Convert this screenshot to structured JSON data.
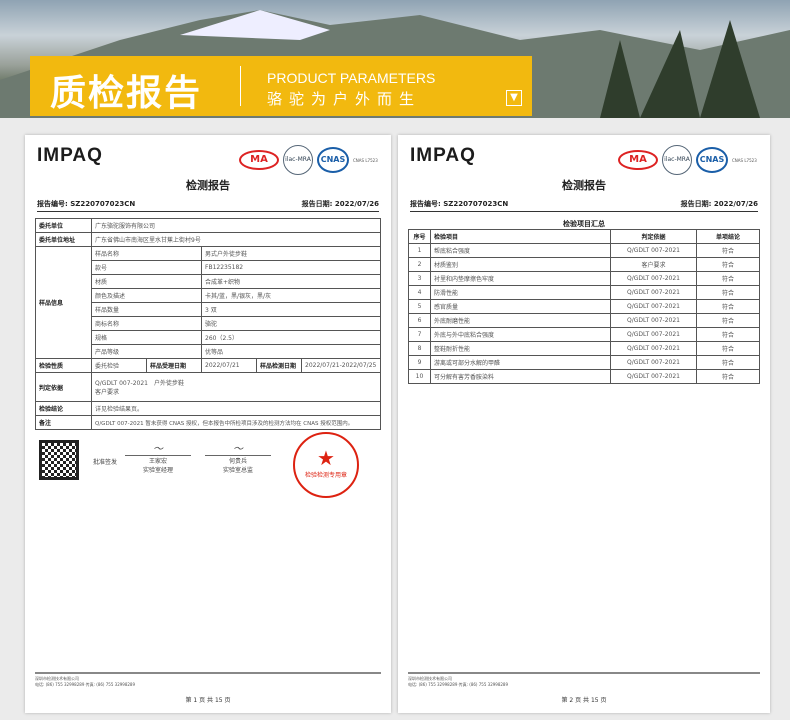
{
  "banner": {
    "title": "质检报告",
    "en": "PRODUCT PARAMETERS",
    "sub": "骆驼为户外而生",
    "download_icon": "chevron-down-icon"
  },
  "logo": "IMPAQ",
  "certs": {
    "ma": "MA",
    "ilac": "ilac-MRA",
    "cnas": "CNAS",
    "cnas_text": "CNAS L7523"
  },
  "page1": {
    "title": "检测报告",
    "report_no": "报告编号: SZ220707023CN",
    "report_date": "报告日期: 2022/07/26",
    "client_label": "委托单位",
    "client": "广东骆驼服饰有限公司",
    "address_label": "委托单位地址",
    "address": "广东省佛山市南海区里水甘蕉上街村9号",
    "sample_label": "样品信息",
    "sample": [
      [
        "样品名称",
        "男式户外徒步鞋"
      ],
      [
        "款号",
        "FB12235182"
      ],
      [
        "材质",
        "合成革+织物"
      ],
      [
        "颜色及描述",
        "卡其/蓝，黑/银灰，黑/灰"
      ],
      [
        "样品数量",
        "3 双"
      ],
      [
        "商标名称",
        "骆驼"
      ],
      [
        "规格",
        "260（2.5）"
      ],
      [
        "产品等级",
        "优等品"
      ]
    ],
    "nature_label": "检验性质",
    "nature": "委托检验",
    "recv_label": "样品受理日期",
    "recv": "2022/07/21",
    "test_label": "样品检测日期",
    "test": "2022/07/21-2022/07/25",
    "basis_label": "判定依据",
    "basis1": "Q/GDLT 007-2021　户外徒步鞋",
    "basis2": "客户要求",
    "conclusion_label": "检验结论",
    "conclusion": "详见检验结果页。",
    "remark_label": "备注",
    "remark": "Q/GDLT 007-2021 暂未获得 CNAS 授权，但本报告中所检项目涉及的检测方法均在 CNAS 授权范围内。",
    "sign_label": "批准签发",
    "signer1": "王家宏",
    "role1": "实验室经理",
    "signer2": "何贵兵",
    "role2": "实验室总监",
    "stamp": "检验检测专用章",
    "footer1": "深圳市检测技术有限公司",
    "footer2": "电话: (86) 755 32998289 传真: (86) 755 32998289",
    "page": "第 1 页 共 15 页"
  },
  "page2": {
    "title": "检测报告",
    "report_no": "报告编号: SZ220707023CN",
    "report_date": "报告日期: 2022/07/26",
    "summary_title": "检验项目汇总",
    "headers": [
      "序号",
      "检验项目",
      "判定依据",
      "单项结论"
    ],
    "rows": [
      [
        "1",
        "帮底粘合强度",
        "Q/GDLT 007-2021",
        "符合"
      ],
      [
        "2",
        "材质鉴别",
        "客户要求",
        "符合"
      ],
      [
        "3",
        "衬里和内垫摩擦色牢度",
        "Q/GDLT 007-2021",
        "符合"
      ],
      [
        "4",
        "防滑性能",
        "Q/GDLT 007-2021",
        "符合"
      ],
      [
        "5",
        "感官质量",
        "Q/GDLT 007-2021",
        "符合"
      ],
      [
        "6",
        "外底耐磨性能",
        "Q/GDLT 007-2021",
        "符合"
      ],
      [
        "7",
        "外底与外中底粘合强度",
        "Q/GDLT 007-2021",
        "符合"
      ],
      [
        "8",
        "整鞋耐折性能",
        "Q/GDLT 007-2021",
        "符合"
      ],
      [
        "9",
        "游离或可部分水解的甲醛",
        "Q/GDLT 007-2021",
        "符合"
      ],
      [
        "10",
        "可分解有害芳香胺染料",
        "Q/GDLT 007-2021",
        "符合"
      ]
    ],
    "footer1": "深圳市检测技术有限公司",
    "footer2": "电话: (86) 755 32998289 传真: (86) 755 32998289",
    "page": "第 2 页 共 15 页"
  }
}
